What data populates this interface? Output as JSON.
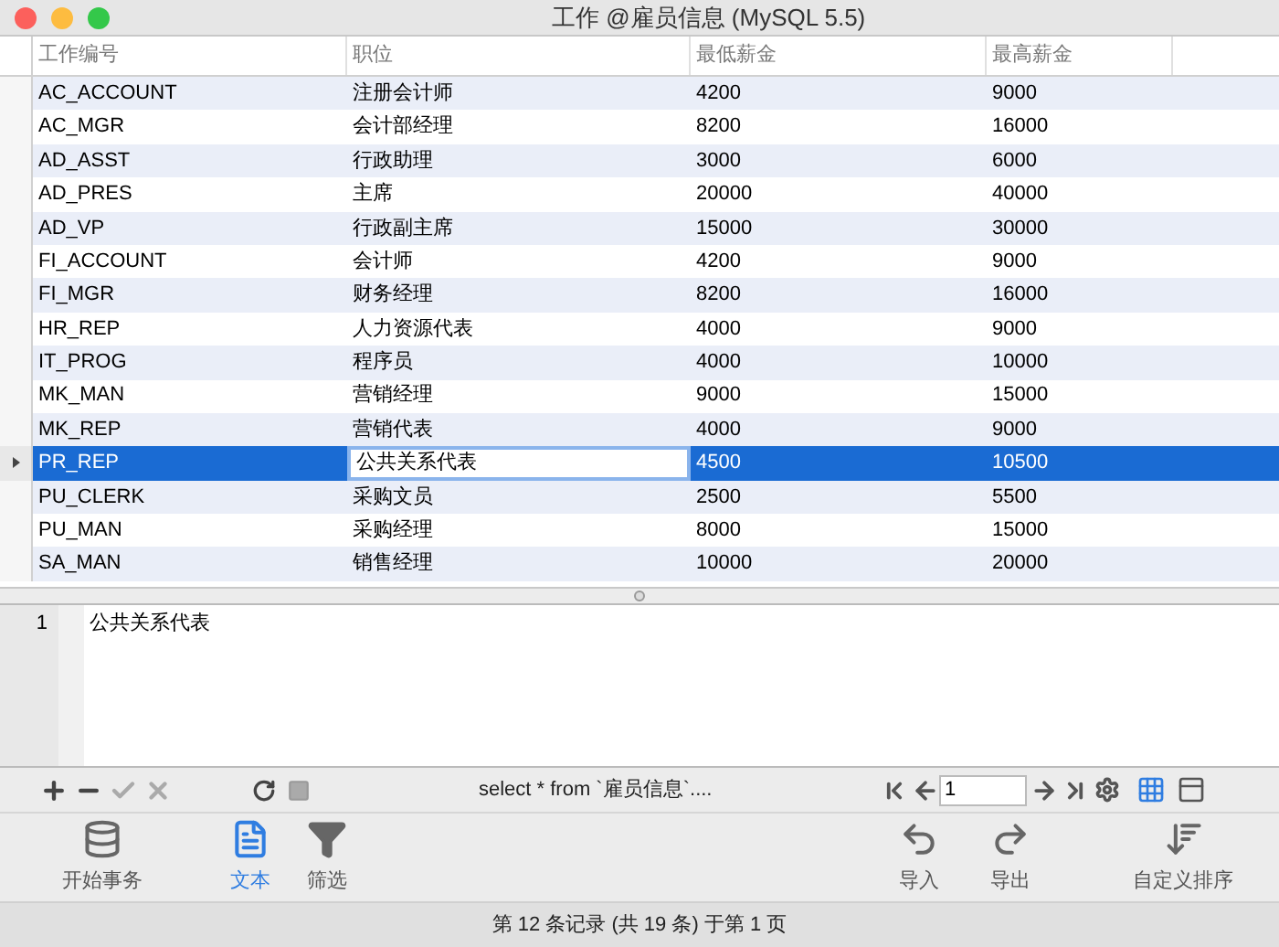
{
  "window": {
    "title": "工作 @雇员信息 (MySQL 5.5)"
  },
  "table": {
    "columns": [
      "工作编号",
      "职位",
      "最低薪金",
      "最高薪金"
    ],
    "rows": [
      {
        "cells": [
          "AC_ACCOUNT",
          "注册会计师",
          "4200",
          "9000"
        ],
        "selected": false
      },
      {
        "cells": [
          "AC_MGR",
          "会计部经理",
          "8200",
          "16000"
        ],
        "selected": false
      },
      {
        "cells": [
          "AD_ASST",
          "行政助理",
          "3000",
          "6000"
        ],
        "selected": false
      },
      {
        "cells": [
          "AD_PRES",
          "主席",
          "20000",
          "40000"
        ],
        "selected": false
      },
      {
        "cells": [
          "AD_VP",
          "行政副主席",
          "15000",
          "30000"
        ],
        "selected": false
      },
      {
        "cells": [
          "FI_ACCOUNT",
          "会计师",
          "4200",
          "9000"
        ],
        "selected": false
      },
      {
        "cells": [
          "FI_MGR",
          "财务经理",
          "8200",
          "16000"
        ],
        "selected": false
      },
      {
        "cells": [
          "HR_REP",
          "人力资源代表",
          "4000",
          "9000"
        ],
        "selected": false
      },
      {
        "cells": [
          "IT_PROG",
          "程序员",
          "4000",
          "10000"
        ],
        "selected": false
      },
      {
        "cells": [
          "MK_MAN",
          "营销经理",
          "9000",
          "15000"
        ],
        "selected": false
      },
      {
        "cells": [
          "MK_REP",
          "营销代表",
          "4000",
          "9000"
        ],
        "selected": false
      },
      {
        "cells": [
          "PR_REP",
          "公共关系代表",
          "4500",
          "10500"
        ],
        "selected": true
      },
      {
        "cells": [
          "PU_CLERK",
          "采购文员",
          "2500",
          "5500"
        ],
        "selected": false
      },
      {
        "cells": [
          "PU_MAN",
          "采购经理",
          "8000",
          "15000"
        ],
        "selected": false
      },
      {
        "cells": [
          "SA_MAN",
          "销售经理",
          "10000",
          "20000"
        ],
        "selected": false
      }
    ]
  },
  "editor": {
    "line_number": "1",
    "text": "公共关系代表"
  },
  "query": "select * from `雇员信息`....",
  "page_field": {
    "value": "1"
  },
  "toolbar": [
    {
      "label": "开始事务",
      "kind": "transaction",
      "selected": false
    },
    {
      "label": "文本",
      "kind": "text",
      "selected": true
    },
    {
      "label": "筛选",
      "kind": "filter",
      "selected": false
    },
    {
      "label": "导入",
      "kind": "import",
      "selected": false
    },
    {
      "label": "导出",
      "kind": "export",
      "selected": false
    },
    {
      "label": "自定义排序",
      "kind": "sort",
      "selected": false
    }
  ],
  "status_bar": "第 12 条记录 (共 19 条) 于第 1 页"
}
